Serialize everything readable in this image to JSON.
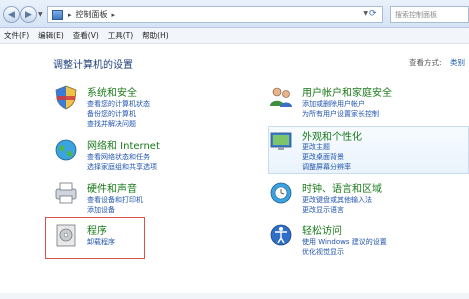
{
  "address": {
    "path": "控制面板",
    "search_placeholder": "搜索控制面板"
  },
  "menu": [
    "文件(F)",
    "编辑(E)",
    "查看(V)",
    "工具(T)",
    "帮助(H)"
  ],
  "page": {
    "title": "调整计算机的设置",
    "view_by_label": "查看方式:",
    "view_by_value": "类别"
  },
  "categories": {
    "system": {
      "title": "系统和安全",
      "links": [
        "查看您的计算机状态",
        "备份您的计算机",
        "查找并解决问题"
      ]
    },
    "network": {
      "title": "网络和 Internet",
      "links": [
        "查看网络状态和任务",
        "选择家庭组和共享选项"
      ]
    },
    "hardware": {
      "title": "硬件和声音",
      "links": [
        "查看设备和打印机",
        "添加设备"
      ]
    },
    "programs": {
      "title": "程序",
      "links": [
        "卸载程序"
      ]
    },
    "users": {
      "title": "用户帐户和家庭安全",
      "links": [
        "添加或删除用户帐户",
        "为所有用户设置家长控制"
      ]
    },
    "appearance": {
      "title": "外观和个性化",
      "links": [
        "更改主题",
        "更改桌面背景",
        "调整屏幕分辨率"
      ]
    },
    "clock": {
      "title": "时钟、语言和区域",
      "links": [
        "更改键盘或其他输入法",
        "更改显示语言"
      ]
    },
    "ease": {
      "title": "轻松访问",
      "links": [
        "使用 Windows 建议的设置",
        "优化视觉显示"
      ]
    }
  }
}
